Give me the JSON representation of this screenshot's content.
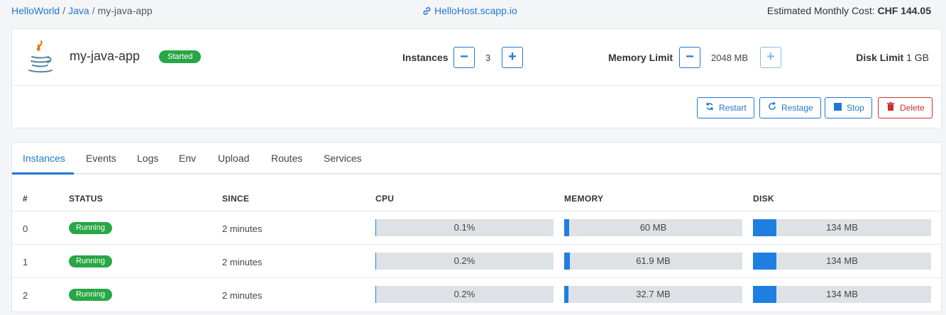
{
  "breadcrumb": {
    "org": "HelloWorld",
    "space": "Java",
    "app": "my-java-app",
    "sep": "/"
  },
  "host": {
    "label": "HelloHost.scapp.io"
  },
  "cost": {
    "label": "Estimated Monthly Cost:",
    "value": "CHF 144.05"
  },
  "app": {
    "name": "my-java-app",
    "status": "Started"
  },
  "instances_ctrl": {
    "label": "Instances",
    "value": "3",
    "minus": "−",
    "plus": "+"
  },
  "memory_ctrl": {
    "label": "Memory Limit",
    "value": "2048 MB",
    "minus": "−",
    "plus": "+"
  },
  "disk": {
    "label": "Disk Limit",
    "value": "1 GB"
  },
  "actions": {
    "restart": "Restart",
    "restage": "Restage",
    "stop": "Stop",
    "delete": "Delete"
  },
  "tabs": [
    "Instances",
    "Events",
    "Logs",
    "Env",
    "Upload",
    "Routes",
    "Services"
  ],
  "table": {
    "headers": [
      "#",
      "STATUS",
      "SINCE",
      "CPU",
      "MEMORY",
      "DISK"
    ],
    "rows": [
      {
        "index": "0",
        "status": "Running",
        "since": "2 minutes",
        "cpu": "0.1%",
        "cpu_frac": 0.001,
        "memory": "60 MB",
        "memory_frac": 0.029,
        "disk": "134 MB",
        "disk_frac": 0.131
      },
      {
        "index": "1",
        "status": "Running",
        "since": "2 minutes",
        "cpu": "0.2%",
        "cpu_frac": 0.002,
        "memory": "61.9 MB",
        "memory_frac": 0.03,
        "disk": "134 MB",
        "disk_frac": 0.131
      },
      {
        "index": "2",
        "status": "Running",
        "since": "2 minutes",
        "cpu": "0.2%",
        "cpu_frac": 0.002,
        "memory": "32.7 MB",
        "memory_frac": 0.016,
        "disk": "134 MB",
        "disk_frac": 0.131
      }
    ]
  },
  "colors": {
    "accent": "#1f78d1",
    "success": "#28a745",
    "danger": "#c9302c",
    "bar_fill": "#1e7fe0",
    "bar_bg": "#dee2e6"
  },
  "icons": {
    "link": "link-icon",
    "java": "java-logo-icon",
    "restart": "refresh-icon",
    "restage": "rotate-icon",
    "stop": "stop-square-icon",
    "delete": "trash-icon"
  }
}
